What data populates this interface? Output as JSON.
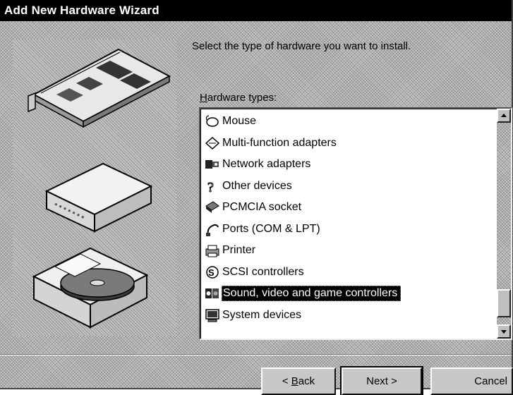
{
  "window": {
    "title": "Add New Hardware Wizard"
  },
  "instruction": "Select the type of hardware you want to install.",
  "hardware_types_label": {
    "accel": "H",
    "rest": "ardware types:"
  },
  "hardware_types": [
    {
      "label": "Mouse",
      "icon": "mouse-icon"
    },
    {
      "label": "Multi-function adapters",
      "icon": "multifunction-icon"
    },
    {
      "label": "Network adapters",
      "icon": "network-adapter-icon"
    },
    {
      "label": "Other devices",
      "icon": "question-icon"
    },
    {
      "label": "PCMCIA socket",
      "icon": "pcmcia-icon"
    },
    {
      "label": "Ports (COM & LPT)",
      "icon": "port-icon"
    },
    {
      "label": "Printer",
      "icon": "printer-icon"
    },
    {
      "label": "SCSI controllers",
      "icon": "scsi-icon"
    },
    {
      "label": "Sound, video and game controllers",
      "icon": "sound-icon",
      "selected": true
    },
    {
      "label": "System devices",
      "icon": "system-icon"
    }
  ],
  "buttons": {
    "back": {
      "prefix": "< ",
      "accel": "B",
      "rest": "ack"
    },
    "next": "Next >",
    "cancel": "Cancel"
  },
  "illustration_items": [
    "expansion-card",
    "modem",
    "cd-drive"
  ]
}
